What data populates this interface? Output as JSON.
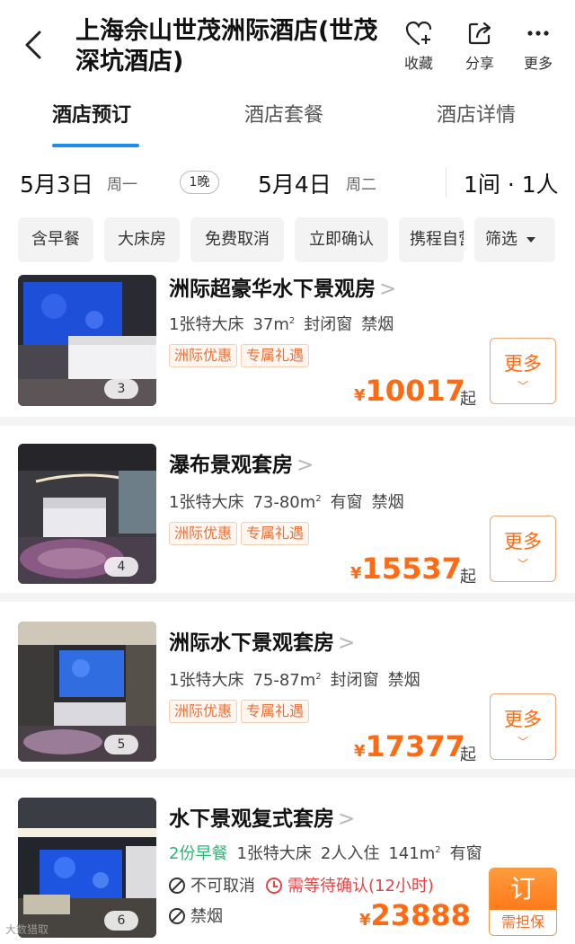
{
  "header": {
    "back_icon": "chevron-left-icon",
    "title": "上海佘山世茂洲际酒店(世茂深坑酒店)",
    "actions": [
      {
        "label": "收藏",
        "icon": "heart-plus-icon"
      },
      {
        "label": "分享",
        "icon": "share-icon"
      },
      {
        "label": "更多",
        "icon": "more-dots-icon"
      }
    ]
  },
  "tabs": [
    {
      "label": "酒店预订",
      "active": true
    },
    {
      "label": "酒店套餐",
      "active": false
    },
    {
      "label": "酒店详情",
      "active": false
    }
  ],
  "dates": {
    "checkin": "5月3日",
    "checkin_weekday": "周一",
    "nights": "1晚",
    "checkout": "5月4日",
    "checkout_weekday": "周二",
    "rooms_guests": "1间 · 1人"
  },
  "filters": [
    "含早餐",
    "大床房",
    "免费取消",
    "立即确认",
    "携程自营"
  ],
  "filter_button": "筛选",
  "rooms": [
    {
      "name": "洲际超豪华水下景观房",
      "bed": "1张特大床",
      "area": "37m",
      "window": "封闭窗",
      "smoke": "禁烟",
      "badges": [
        "洲际优惠",
        "专属礼遇"
      ],
      "currency": "¥",
      "price": "10017",
      "price_suffix": "起",
      "more_label": "更多",
      "photo_count": "3"
    },
    {
      "name": "瀑布景观套房",
      "bed": "1张特大床",
      "area": "73-80m",
      "window": "有窗",
      "smoke": "禁烟",
      "badges": [
        "洲际优惠",
        "专属礼遇"
      ],
      "currency": "¥",
      "price": "15537",
      "price_suffix": "起",
      "more_label": "更多",
      "photo_count": "4"
    },
    {
      "name": "洲际水下景观套房",
      "bed": "1张特大床",
      "area": "75-87m",
      "window": "封闭窗",
      "smoke": "禁烟",
      "badges": [
        "洲际优惠",
        "专属礼遇"
      ],
      "currency": "¥",
      "price": "17377",
      "price_suffix": "起",
      "more_label": "更多",
      "photo_count": "5"
    },
    {
      "name": "水下景观复式套房",
      "breakfast": "2份早餐",
      "bed": "1张特大床",
      "occupancy": "2人入住",
      "area": "141m",
      "window": "有窗",
      "cancel": "不可取消",
      "confirm": "需等待确认(12小时)",
      "smoke": "禁烟",
      "currency": "¥",
      "price": "23888",
      "book_label": "订",
      "guarantee": "需担保",
      "photo_count": "6"
    }
  ],
  "area_unit": "2",
  "watermark": "大数猎取",
  "colors": {
    "accent_blue": "#1f8ded",
    "price_orange": "#ff6a13",
    "green": "#2bb673",
    "red": "#e64545"
  }
}
